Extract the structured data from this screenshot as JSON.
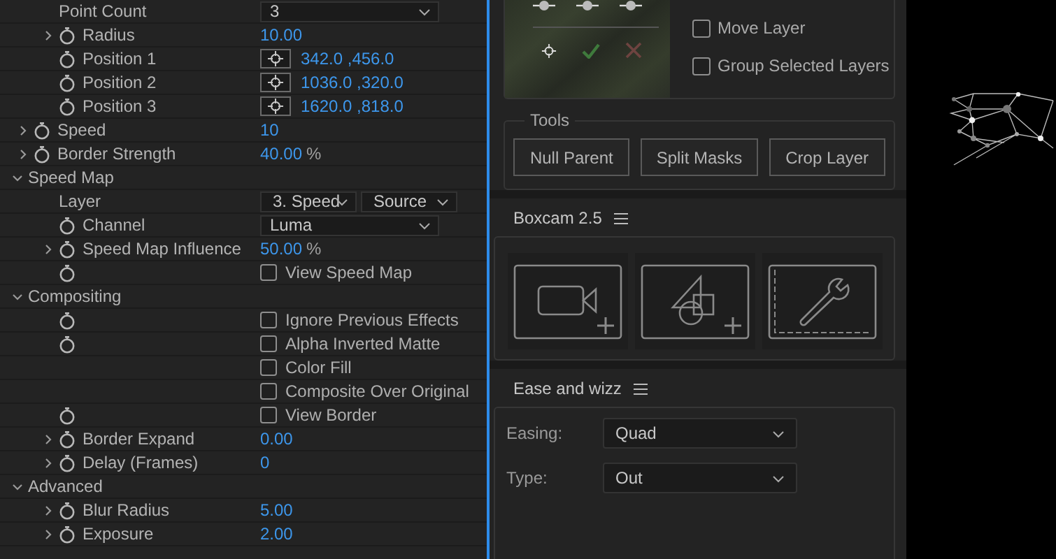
{
  "effect_controls": {
    "rows": [
      {
        "kind": "group",
        "children": [
          {
            "kind": "dropdown",
            "label": "Point Count",
            "stopwatch": false,
            "value": "3"
          },
          {
            "kind": "number",
            "label": "Radius",
            "expanded": false,
            "stopwatch": true,
            "value": "10.00"
          },
          {
            "kind": "point",
            "label": "Position 1",
            "stopwatch": true,
            "value": "342.0 ,456.0"
          },
          {
            "kind": "point",
            "label": "Position 2",
            "stopwatch": true,
            "value": "1036.0 ,320.0"
          },
          {
            "kind": "point",
            "label": "Position 3",
            "stopwatch": true,
            "value": "1620.0 ,818.0"
          }
        ]
      },
      {
        "kind": "number",
        "label": "Speed",
        "expanded": false,
        "stopwatch": true,
        "value": "10"
      },
      {
        "kind": "number",
        "label": "Border Strength",
        "expanded": false,
        "stopwatch": true,
        "value": "40.00",
        "unit": "%"
      },
      {
        "kind": "group",
        "label": "Speed Map",
        "expanded": true,
        "children": [
          {
            "kind": "layer",
            "label": "Layer",
            "stopwatch": false,
            "values": [
              "3. Speed",
              "Source"
            ]
          },
          {
            "kind": "dropdown",
            "label": "Channel",
            "stopwatch": true,
            "value": "Luma"
          },
          {
            "kind": "number",
            "label": "Speed Map Influence",
            "expanded": false,
            "stopwatch": true,
            "value": "50.00",
            "unit": "%"
          },
          {
            "kind": "checkbox",
            "stopwatch": true,
            "text": "View Speed Map",
            "checked": false
          }
        ]
      },
      {
        "kind": "group",
        "label": "Compositing",
        "expanded": true,
        "children": [
          {
            "kind": "checkbox",
            "stopwatch": true,
            "text": "Ignore Previous Effects",
            "checked": false
          },
          {
            "kind": "checkbox",
            "stopwatch": true,
            "text": "Alpha Inverted Matte",
            "checked": false
          },
          {
            "kind": "checkbox",
            "stopwatch": false,
            "text": "Color Fill",
            "checked": false
          },
          {
            "kind": "checkbox",
            "stopwatch": false,
            "text": "Composite Over Original",
            "checked": false
          },
          {
            "kind": "checkbox",
            "stopwatch": true,
            "text": "View Border",
            "checked": false
          },
          {
            "kind": "number",
            "label": "Border Expand",
            "expanded": false,
            "stopwatch": true,
            "value": "0.00"
          },
          {
            "kind": "number",
            "label": "Delay (Frames)",
            "expanded": false,
            "stopwatch": true,
            "value": "0"
          }
        ]
      },
      {
        "kind": "group",
        "label": "Advanced",
        "expanded": true,
        "children": [
          {
            "kind": "number",
            "label": "Blur Radius",
            "expanded": false,
            "stopwatch": true,
            "value": "5.00"
          },
          {
            "kind": "number",
            "label": "Exposure",
            "expanded": false,
            "stopwatch": true,
            "value": "2.00"
          }
        ]
      }
    ]
  },
  "tool_panel": {
    "options": [
      {
        "label": "Move Layer",
        "checked": false
      },
      {
        "label": "Group Selected Layers",
        "checked": false
      }
    ],
    "tools": {
      "title": "Tools",
      "buttons": [
        "Null Parent",
        "Split Masks",
        "Crop Layer"
      ]
    }
  },
  "boxcam": {
    "title": "Boxcam 2.5",
    "tiles": [
      {
        "kind": "camera"
      },
      {
        "kind": "shapes"
      },
      {
        "kind": "settings"
      }
    ]
  },
  "ease_and_wizz": {
    "title": "Ease and wizz",
    "fields": [
      {
        "label": "Easing:",
        "value": "Quad"
      },
      {
        "label": "Type:",
        "value": "Out"
      }
    ]
  }
}
